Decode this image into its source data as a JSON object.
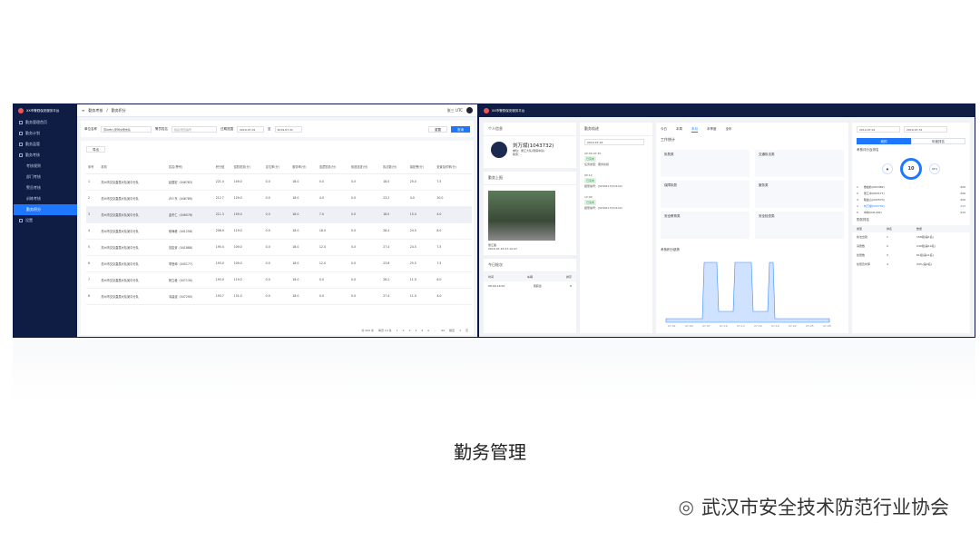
{
  "left_app": {
    "brand": "XX市警勤保安服务平台",
    "menu": [
      {
        "label": "勤务管理首页",
        "active": false
      },
      {
        "label": "勤务计划",
        "active": false
      },
      {
        "label": "勤务监管",
        "active": false
      },
      {
        "label": "勤务考核",
        "active": false
      },
      {
        "label": "考核规则",
        "active": false
      },
      {
        "label": "部门考核",
        "active": false
      },
      {
        "label": "警员考核",
        "active": false
      },
      {
        "label": "训练考核",
        "active": false
      },
      {
        "label": "勤务积分",
        "active": true
      },
      {
        "label": "设置",
        "active": false
      }
    ],
    "breadcrumb": {
      "section": "勤务考核",
      "page": "勤务积分"
    },
    "user": "张三 UTC",
    "filters": {
      "unit_label": "单位名称",
      "unit_value": "苏州市公安局交警支队",
      "name_label": "警员姓名",
      "name_placeholder": "姓名/警员编号",
      "date_label": "日期范围",
      "start": "2019-07-01",
      "end": "2019-07-31",
      "reset": "重置",
      "search": "查询"
    },
    "export": "导出",
    "columns": [
      "序号",
      "机构",
      "姓名(警号)",
      "积分值",
      "巡防勤务(分)",
      "定位率(分)",
      "服务率(分)",
      "巡逻勤务(分)",
      "街道巡查(分)",
      "执法数(分)",
      "接处警(分)",
      "处置及时率(分)"
    ],
    "rows": [
      [
        "1",
        "苏州市交队直属大队吴中分队",
        "赵国宏（046783）",
        "221.4",
        "149.0",
        "0.0",
        "18.0",
        "0.0",
        "0.0",
        "18.0",
        "25.0",
        "7.5"
      ],
      [
        "2",
        "苏州市交队直属大队吴中分队",
        "卢少东（046789）",
        "212.7",
        "129.0",
        "0.0",
        "18.0",
        "4.0",
        "0.0",
        "23.2",
        "4.0",
        "10.0"
      ],
      [
        "3",
        "苏州市交队直属大队吴中分队",
        "金冬仁（046578）",
        "211.3",
        "159.0",
        "0.0",
        "18.0",
        "7.0",
        "0.0",
        "18.0",
        "15.0",
        "4.0"
      ],
      [
        "4",
        "苏州市交队直属大队吴中分队",
        "杨海峰（041256）",
        "206.9",
        "119.0",
        "0.0",
        "18.0",
        "18.0",
        "0.0",
        "28.4",
        "24.5",
        "8.0"
      ],
      [
        "5",
        "苏州市交队直属大队吴中分队",
        "范岩景（041888）",
        "195.4",
        "109.0",
        "0.0",
        "18.0",
        "12.0",
        "0.0",
        "27.4",
        "24.5",
        "7.5"
      ],
      [
        "6",
        "苏州市交队直属大队吴中分队",
        "李慧坤（045177）",
        "193.0",
        "109.0",
        "0.0",
        "18.0",
        "12.0",
        "0.0",
        "23.8",
        "25.5",
        "7.5"
      ],
      [
        "7",
        "苏州市交队直属大队吴中分队",
        "杨立峰（047130）",
        "193.0",
        "119.0",
        "0.0",
        "18.0",
        "0.0",
        "0.0",
        "28.2",
        "11.0",
        "6.0"
      ],
      [
        "8",
        "苏州市交队直属大队吴中分队",
        "韦建波（047295）",
        "193.7",
        "131.0",
        "0.0",
        "18.0",
        "0.0",
        "0.0",
        "27.4",
        "11.0",
        "4.0"
      ]
    ],
    "pager": {
      "total": "共 999 条",
      "per": "每页 10 条",
      "pages": [
        "1",
        "2",
        "3",
        "4",
        "5",
        "6",
        "…",
        "99"
      ],
      "goto": "跳至",
      "page": "1",
      "unit": "页"
    }
  },
  "right_app": {
    "brand": "XX市警勤保安服务平台",
    "profile_title": "个人信息",
    "officer": "刘万斌(1043732)",
    "officer_unit": "单位：吴江大队(南麻中队)",
    "officer_role": "职务：-",
    "onduty_title": "勤务上报",
    "photo_caption": "吴江路",
    "photo_time": "2019-07-15 07:12:47",
    "today_title": "今日轮次",
    "today_cols": [
      "时间",
      "车辆",
      "排序"
    ],
    "today_row": [
      "08:00-16:00",
      "南麻巡",
      "8"
    ],
    "track_title": "勤务轨迹",
    "track_date": "2019-07-16",
    "track_items": [
      {
        "time": "20:00-07:30",
        "tag": "已完成",
        "text": "任务类型：服务执勤"
      },
      {
        "time": "09:12",
        "tag": "已完成",
        "text": "报警编号：J3200517(SO1A0)"
      },
      {
        "time": "12:00",
        "tag": "已完成",
        "text": "报警编号：J3200517(SO1A0)"
      }
    ],
    "tabs": [
      "今日",
      "本周",
      "本月",
      "本季度",
      "全年"
    ],
    "work_title": "工作统计",
    "groups": [
      "执勤类",
      "交通执法类",
      "保障执勤",
      "服务类",
      "安全教育类",
      "安全检查类"
    ],
    "trend_title": "考核积分趋势",
    "trend_xlabels": [
      "07-01",
      "07-04",
      "07-07",
      "07-10",
      "07-13",
      "07-16",
      "07-19",
      "07-22",
      "07-25",
      "07-28"
    ],
    "date_from": "2019-07-01",
    "date_to": "2019-07-31",
    "rank_title": "考核评分及排名",
    "rank_toggle": [
      "我的",
      "年度排名"
    ],
    "score": "10",
    "pct": "94%",
    "rank_rows": [
      [
        "1",
        "楼峻岭(063482)",
        "220"
      ],
      [
        "2",
        "吴江中(063177)",
        "220"
      ],
      [
        "3",
        "程金山(043570)",
        "220"
      ],
      [
        "4",
        "刘万斌(043732)",
        "213"
      ],
      [
        "5",
        "中林(041292)",
        "212"
      ]
    ],
    "attend_title": "勤务排名",
    "attend_cols": [
      "类型",
      "排名",
      "数量"
    ],
    "attend_rows": [
      [
        "执法出勤",
        "1",
        "158组(第1名)"
      ],
      [
        "请警数",
        "2",
        "240组(第10名)"
      ],
      [
        "处警数",
        "3",
        "61组(第11名)"
      ],
      [
        "处警及时率",
        "4",
        "94%(第2名)"
      ]
    ]
  },
  "caption": "勤务管理",
  "watermark": "武汉市安全技术防范行业协会"
}
